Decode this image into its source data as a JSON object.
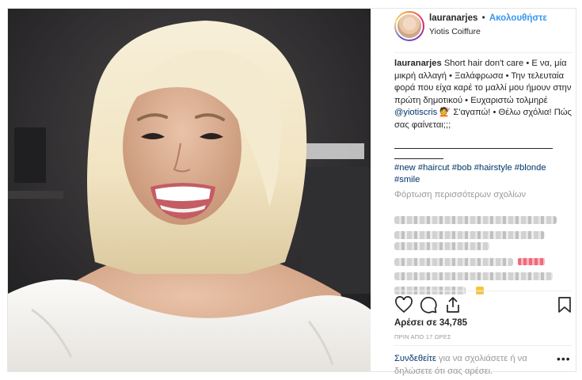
{
  "post": {
    "username": "lauranarjes",
    "separator": "•",
    "follow_label": "Ακολουθήστε",
    "location": "Yiotis Coiffure",
    "caption": {
      "user": "lauranarjes",
      "text_part1": "Short hair don't care • Ε να, μία μικρή αλλαγή • Ξαλάφρωσα • Την τελευταία φορά που είχα καρέ το μαλλί μου ήμουν στην πρώτη δημοτικού • Ευχαριστώ τολμηρέ",
      "mention": "@yiotiscris",
      "text_part2": "💇 Σ'αγαπώ! • Θέλω σχόλια! Πώς σας φαίνεται;;;"
    },
    "hashtags": [
      "#new",
      "#haircut",
      "#bob",
      "#hairstyle",
      "#blonde",
      "#smile"
    ],
    "load_more": "Φόρτωση περισσότερων σχολίων",
    "likes": "Αρέσει σε 34,785",
    "time": "ΠΡΙΝ ΑΠΟ 17 ΩΡΕΣ",
    "footer": {
      "login_link": "Συνδεθείτε",
      "text": " για να σχολιάσετε ή να δηλώσετε ότι σας αρέσει."
    },
    "more_options": "•••"
  },
  "icons": {
    "like": "heart-icon",
    "comment": "comment-icon",
    "share": "share-icon",
    "save": "bookmark-icon"
  },
  "colors": {
    "link_blue": "#3897f0",
    "hashtag_navy": "#003569",
    "muted_gray": "#999999"
  }
}
